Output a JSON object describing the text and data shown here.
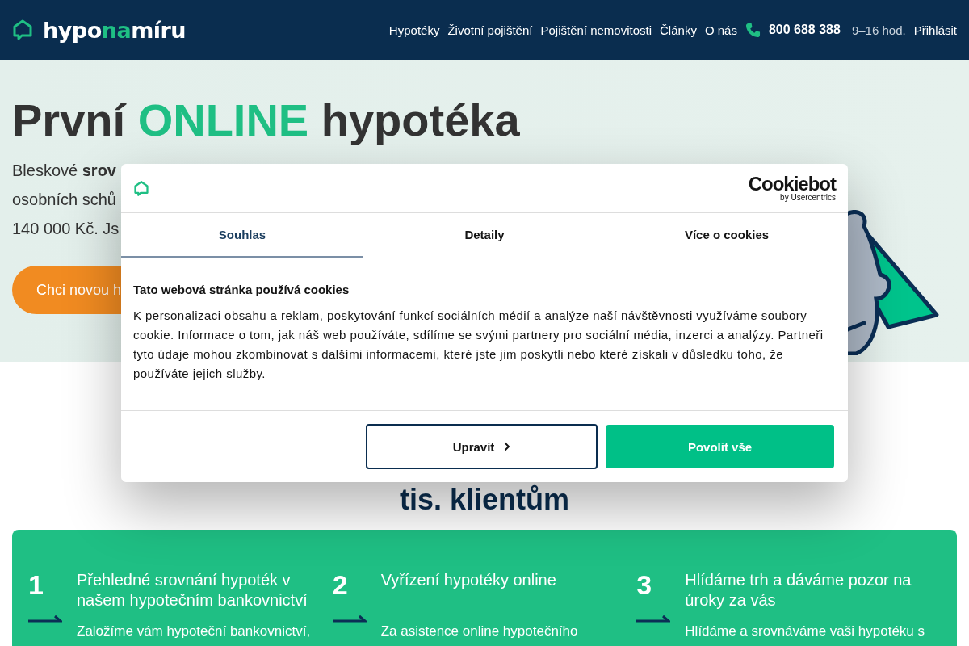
{
  "header": {
    "logo": {
      "start": "hypo",
      "accent": "na",
      "end": "míru"
    },
    "nav": [
      "Hypotéky",
      "Životní pojištění",
      "Pojištění nemovitosti",
      "Články",
      "O nás"
    ],
    "phone": "800 688 388",
    "hours": "9–16 hod.",
    "login": "Přihlásit"
  },
  "hero": {
    "headline": {
      "start": "První ",
      "accent": "ONLINE",
      "end": " hypotéka"
    },
    "lines": [
      "Bleskové **srov**",
      "osobních schů",
      "140 000 Kč. Js"
    ],
    "cta": "Chci novou h"
  },
  "section_heading": "tis. klientům",
  "steps": [
    {
      "number": "1",
      "title": "Přehledné srovnání hypoték v našem hypotečním bankovnictví",
      "text": "Založíme vám hypoteční bankovnictví,"
    },
    {
      "number": "2",
      "title": "Vyřízení hypotéky online",
      "text": "Za asistence online hypotečního"
    },
    {
      "number": "3",
      "title": "Hlídáme trh a dáváme pozor na úroky za vás",
      "text": "Hlídáme a srovnáváme vaši hypotéku s"
    }
  ],
  "cookie_dialog": {
    "brand": "Cookiebot",
    "brand_sub": "by Usercentrics",
    "tabs": [
      {
        "label": "Souhlas",
        "selected": true
      },
      {
        "label": "Detaily",
        "selected": false
      },
      {
        "label": "Více o cookies",
        "selected": false
      }
    ],
    "title": "Tato webová stránka používá cookies",
    "body": "K personalizaci obsahu a reklam, poskytování funkcí sociálních médií a analýze naší návštěvnosti využíváme soubory cookie. Informace o tom, jak náš web používáte, sdílíme se svými partnery pro sociální média, inzerci a analýzy. Partneři tyto údaje mohou zkombinovat s dalšími informacemi, které jste jim poskytli nebo které získali v důsledku toho, že používáte jejich služby.",
    "buttons": [
      {
        "label": "Upravit",
        "kind": "outline"
      },
      {
        "label": "Povolit vše",
        "kind": "primary"
      }
    ]
  }
}
